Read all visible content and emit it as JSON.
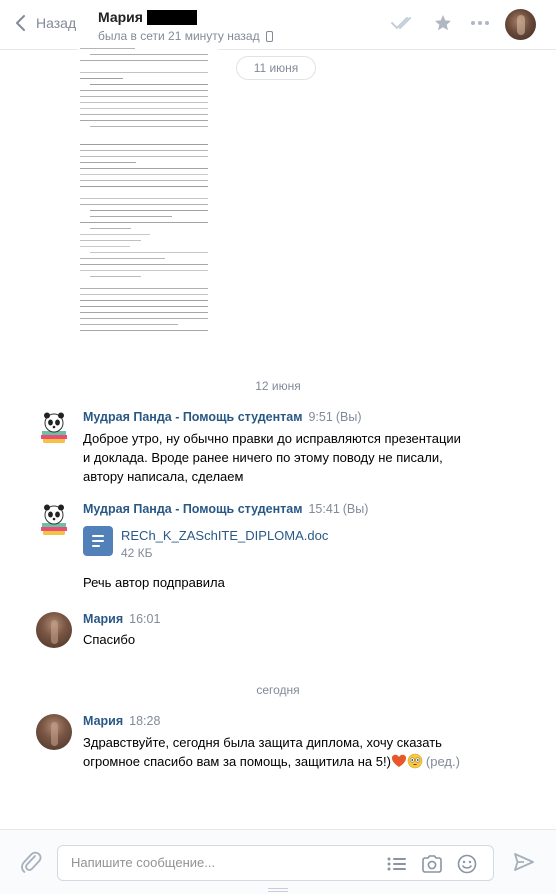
{
  "header": {
    "back_label": "Назад",
    "contact_name": "Мария",
    "status": "была в сети 21 минуту назад"
  },
  "dates": {
    "pill": "11 июня",
    "june12": "12 июня",
    "today": "сегодня"
  },
  "messages": [
    {
      "author": "Мудрая Панда - Помощь студентам",
      "time": "9:51",
      "you": "(Вы)",
      "lines": [
        "Доброе утро, ну обычно правки до исправляются презентации",
        "и доклада. Вроде ранее ничего по этому поводу не писали,",
        "автору написала, сделаем"
      ]
    },
    {
      "author": "Мудрая Панда - Помощь студентам",
      "time": "15:41",
      "you": "(Вы)",
      "file_name": "RECh_K_ZASchITE_DIPLOMA.doc",
      "file_size": "42 КБ",
      "followup": "Речь автор подправила"
    },
    {
      "author": "Мария",
      "time": "16:01",
      "text": "Спасибо"
    },
    {
      "author": "Мария",
      "time": "18:28",
      "lines": [
        "Здравствуйте, сегодня была защита диплома, хочу сказать",
        "огромное спасибо вам за помощь, защитила на 5!)"
      ],
      "edited": "(ред.)"
    }
  ],
  "composer": {
    "placeholder": "Напишите сообщение..."
  },
  "colors": {
    "link": "#2a5885",
    "muted": "#828a99",
    "accent": "#5181b8"
  }
}
